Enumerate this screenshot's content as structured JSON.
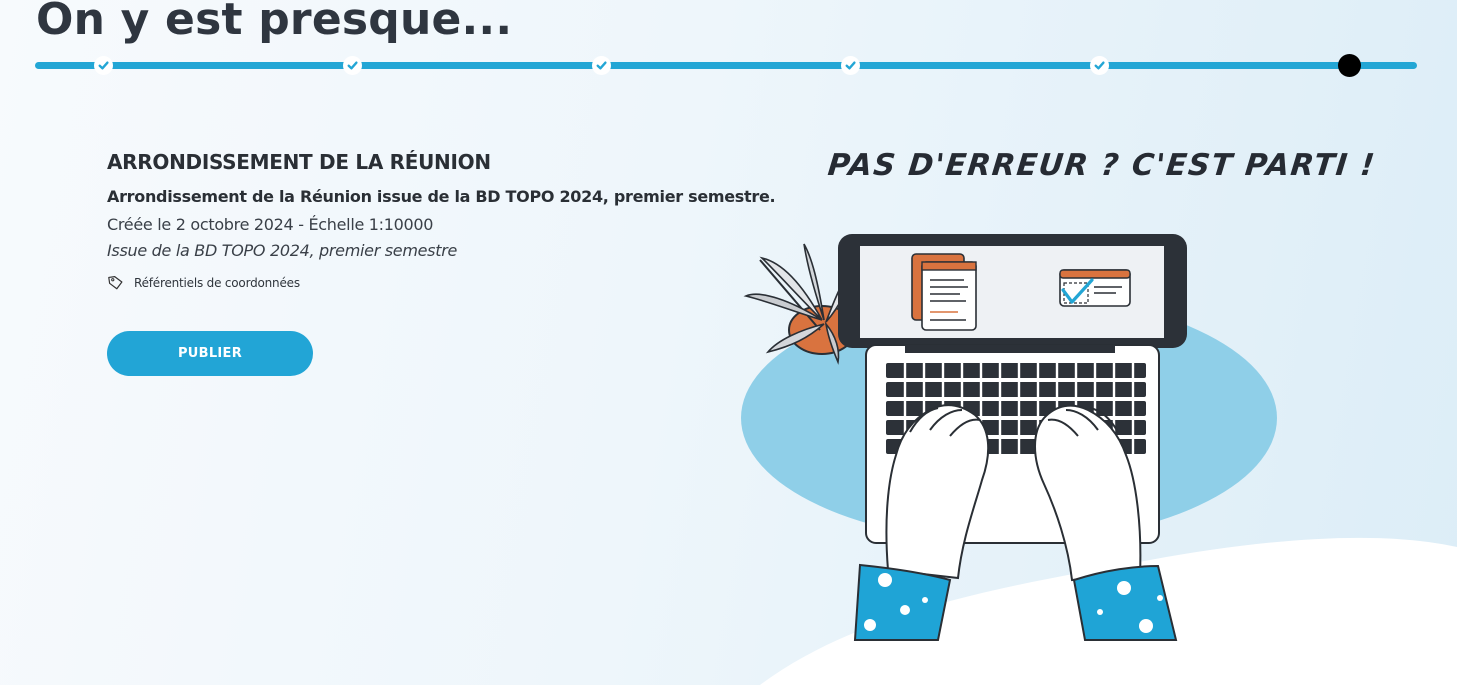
{
  "page": {
    "title": "On y est presque..."
  },
  "stepper": {
    "steps": [
      {
        "status": "completed"
      },
      {
        "status": "completed"
      },
      {
        "status": "completed"
      },
      {
        "status": "completed"
      },
      {
        "status": "completed"
      },
      {
        "status": "current"
      }
    ],
    "colors": {
      "track": "#23a6d5",
      "current": "#000000",
      "done_fill": "#ffffff"
    }
  },
  "dataset": {
    "title": "ARRONDISSEMENT DE LA RÉUNION",
    "subtitle": "Arrondissement de la Réunion issue de la BD TOPO 2024, premier semestre.",
    "meta": "Créée le  2 octobre 2024 - Échelle  1:10000",
    "description": "Issue de la BD TOPO 2024, premier semestre",
    "tag_icon": "tag-icon",
    "tag_label": "Référentiels de coordonnées"
  },
  "actions": {
    "publish_label": "PUBLIER",
    "publish_color": "#22a5d6"
  },
  "illustration": {
    "caption": "PAS D'ERREUR ? C'EST PARTI !"
  }
}
